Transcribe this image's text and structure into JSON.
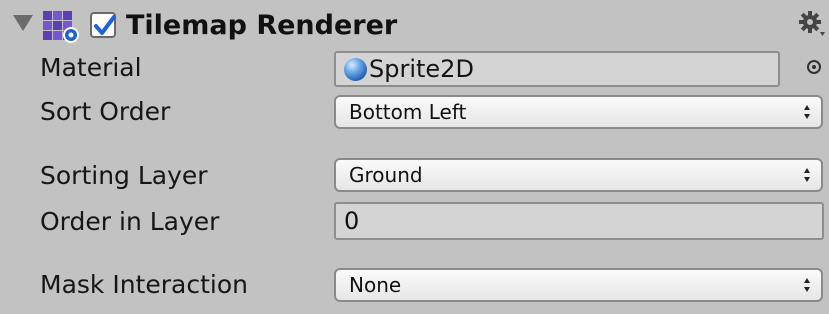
{
  "component": {
    "title": "Tilemap Renderer",
    "enabled": true
  },
  "icons": {
    "foldout": "foldout-triangle-icon",
    "component": "tilemap-icon",
    "checkbox": "checkmark-icon",
    "settings": "gear-icon",
    "material": "sphere-icon",
    "picker": "object-picker-icon",
    "dropdown": "up-down-arrows-icon"
  },
  "colors": {
    "panel_background": "#c2c2c2",
    "tilemap_icon_purple": "#5b3fb3",
    "checkmark_blue": "#1f62d6"
  },
  "fields": {
    "material": {
      "label": "Material",
      "value": "Sprite2D"
    },
    "sort_order": {
      "label": "Sort Order",
      "value": "Bottom Left"
    },
    "sorting_layer": {
      "label": "Sorting Layer",
      "value": "Ground"
    },
    "order_in_layer": {
      "label": "Order in Layer",
      "value": "0"
    },
    "mask_interaction": {
      "label": "Mask Interaction",
      "value": "None"
    }
  }
}
